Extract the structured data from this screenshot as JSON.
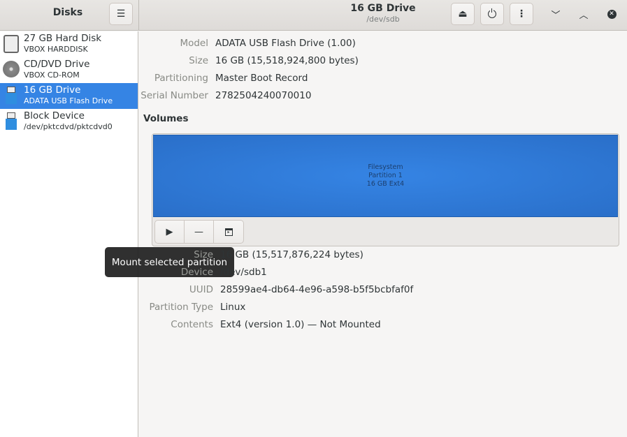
{
  "sidebar": {
    "title": "Disks",
    "items": [
      {
        "name": "27 GB Hard Disk",
        "sub": "VBOX HARDDISK",
        "icon": "hard-disk-icon"
      },
      {
        "name": "CD/DVD Drive",
        "sub": "VBOX CD-ROM",
        "icon": "optical-disc-icon"
      },
      {
        "name": "16 GB Drive",
        "sub": "ADATA USB Flash Drive",
        "icon": "usb-drive-icon",
        "selected": true
      },
      {
        "name": "Block Device",
        "sub": "/dev/pktcdvd/pktcdvd0",
        "icon": "usb-drive-icon"
      }
    ]
  },
  "header": {
    "title": "16 GB Drive",
    "subtitle": "/dev/sdb"
  },
  "drive": [
    {
      "label": "Model",
      "value": "ADATA USB Flash Drive (1.00)"
    },
    {
      "label": "Size",
      "value": "16 GB (15,518,924,800 bytes)"
    },
    {
      "label": "Partitioning",
      "value": "Master Boot Record"
    },
    {
      "label": "Serial Number",
      "value": "2782504240070010"
    }
  ],
  "volumes": {
    "heading": "Volumes",
    "partition": {
      "line1": "Filesystem",
      "line2": "Partition 1",
      "line3": "16 GB Ext4"
    }
  },
  "partition": [
    {
      "label": "Size",
      "value": "16 GB (15,517,876,224 bytes)"
    },
    {
      "label": "Device",
      "value": "/dev/sdb1"
    },
    {
      "label": "UUID",
      "value": "28599ae4-db64-4e96-a598-b5f5bcbfaf0f"
    },
    {
      "label": "Partition Type",
      "value": "Linux"
    },
    {
      "label": "Contents",
      "value": "Ext4 (version 1.0) — Not Mounted"
    }
  ],
  "tooltip": "Mount selected partition",
  "colors": {
    "accent": "#3584e4"
  }
}
